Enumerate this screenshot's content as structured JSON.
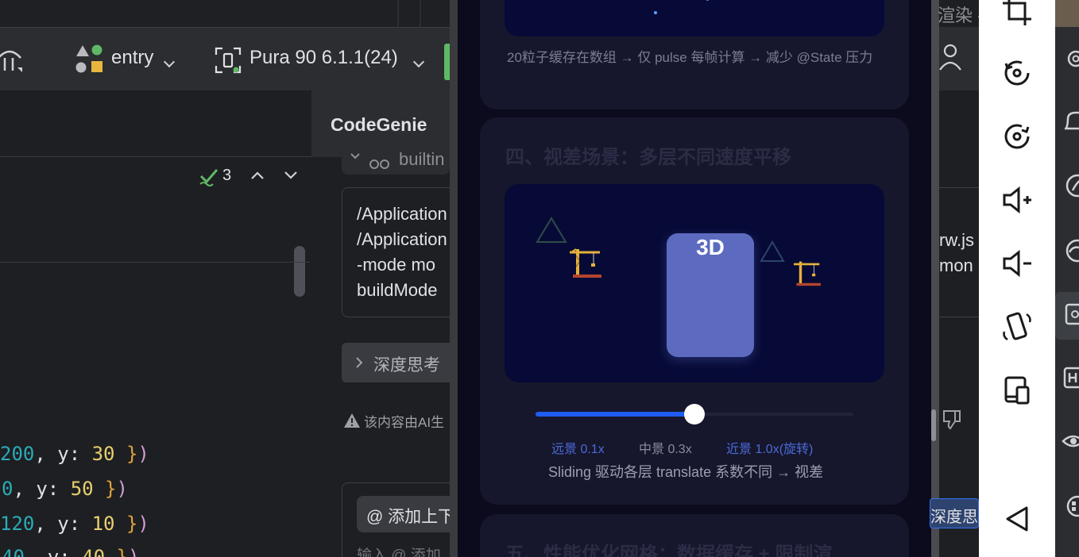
{
  "ide": {
    "module": "entry",
    "device": "Pura 90 6.1.1(24)",
    "panel_title": "CodeGenie",
    "inspection_count": "3",
    "builtin_label": "builtin",
    "terminal_lines": [
      "/Application",
      "/Application",
      "-mode mo",
      "buildMode"
    ],
    "deep_think": "深度思考",
    "ai_notice": "该内容由AI生",
    "add_context": "@ 添加上下",
    "input_placeholder": "输入 @ 添加",
    "right_text_1": "渲染 -",
    "right_text_2": "rw.js",
    "right_text_3": "mon",
    "right_deep": "深度思",
    "code": [
      {
        "a": "200",
        "b": "30"
      },
      {
        "a": "0",
        "b": "50"
      },
      {
        "a": "120",
        "b": "10"
      },
      {
        "a": "40",
        "b": "40"
      }
    ],
    "colors": {
      "accent": "#3574f0",
      "bg": "#1e1f22",
      "toolbar": "#2b2d30"
    }
  },
  "app": {
    "caption_particles": "20粒子缓存在数组 → 仅 pulse 每帧计算 → 减少 @State 压力",
    "section4_title": "四、视差场景：多层不同速度平移",
    "block_label": "3D",
    "slider_value": 0.5,
    "layer_far": "远景 0.1x",
    "layer_mid": "中景 0.3x",
    "layer_near": "近景 1.0x(旋转)",
    "slider_caption": "Sliding 驱动各层 translate 系数不同 → 视差",
    "section5_title": "五、性能优化网格：数据缓存 + 限制渲",
    "colors": {
      "card": "#16172c",
      "scene": "#070a36",
      "block": "#5c6bc0",
      "slider": "#1f5cf2",
      "layer_blue": "#4a6ad8",
      "layer_grey": "#8a8c9c"
    }
  },
  "emulator": {
    "icons": [
      "crop-icon",
      "rotate-left-icon",
      "rotate-right-icon",
      "volume-up-icon",
      "volume-down-icon",
      "shake-icon",
      "fold-icon",
      "back-icon"
    ]
  }
}
